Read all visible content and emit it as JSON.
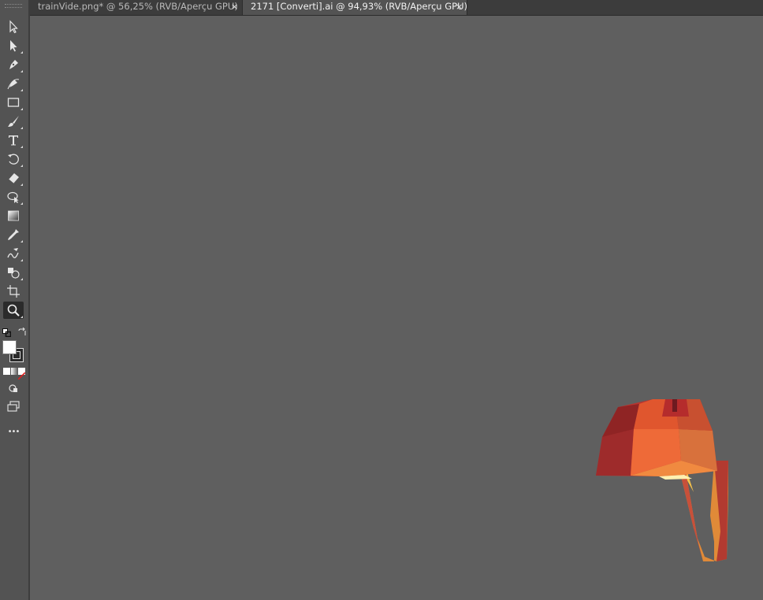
{
  "tabs": [
    {
      "label": "trainVide.png* @ 56,25% (RVB/Aperçu GPU)",
      "active": false,
      "close": "×"
    },
    {
      "label": "2171 [Converti].ai @ 94,93% (RVB/Aperçu GPU)",
      "active": true,
      "close": "×"
    }
  ],
  "toolbar": {
    "tools": [
      {
        "name": "selection-tool",
        "icon": "arrow-outline-icon"
      },
      {
        "name": "direct-selection-tool",
        "icon": "arrow-filled-icon"
      },
      {
        "name": "pen-tool",
        "icon": "pen-icon"
      },
      {
        "name": "curvature-tool",
        "icon": "curvature-pen-icon"
      },
      {
        "name": "rectangle-tool",
        "icon": "rectangle-icon"
      },
      {
        "name": "paintbrush-tool",
        "icon": "brush-icon"
      },
      {
        "name": "type-tool",
        "icon": "type-icon"
      },
      {
        "name": "rotate-tool",
        "icon": "rotate-icon"
      },
      {
        "name": "eraser-tool",
        "icon": "eraser-icon"
      },
      {
        "name": "puppet-warp-tool",
        "icon": "warp-icon"
      },
      {
        "name": "gradient-tool",
        "icon": "gradient-icon"
      },
      {
        "name": "eyedropper-tool",
        "icon": "eyedropper-icon"
      },
      {
        "name": "blend-tool",
        "icon": "blend-icon"
      },
      {
        "name": "shape-builder-tool",
        "icon": "shape-builder-icon"
      },
      {
        "name": "artboard-tool",
        "icon": "artboard-icon"
      },
      {
        "name": "zoom-tool",
        "icon": "magnifier-icon",
        "active": true
      }
    ],
    "more": "•••"
  },
  "colors": {
    "fill": "#ffffff",
    "stroke": "#000000",
    "canvas": "#5f5f5f"
  }
}
